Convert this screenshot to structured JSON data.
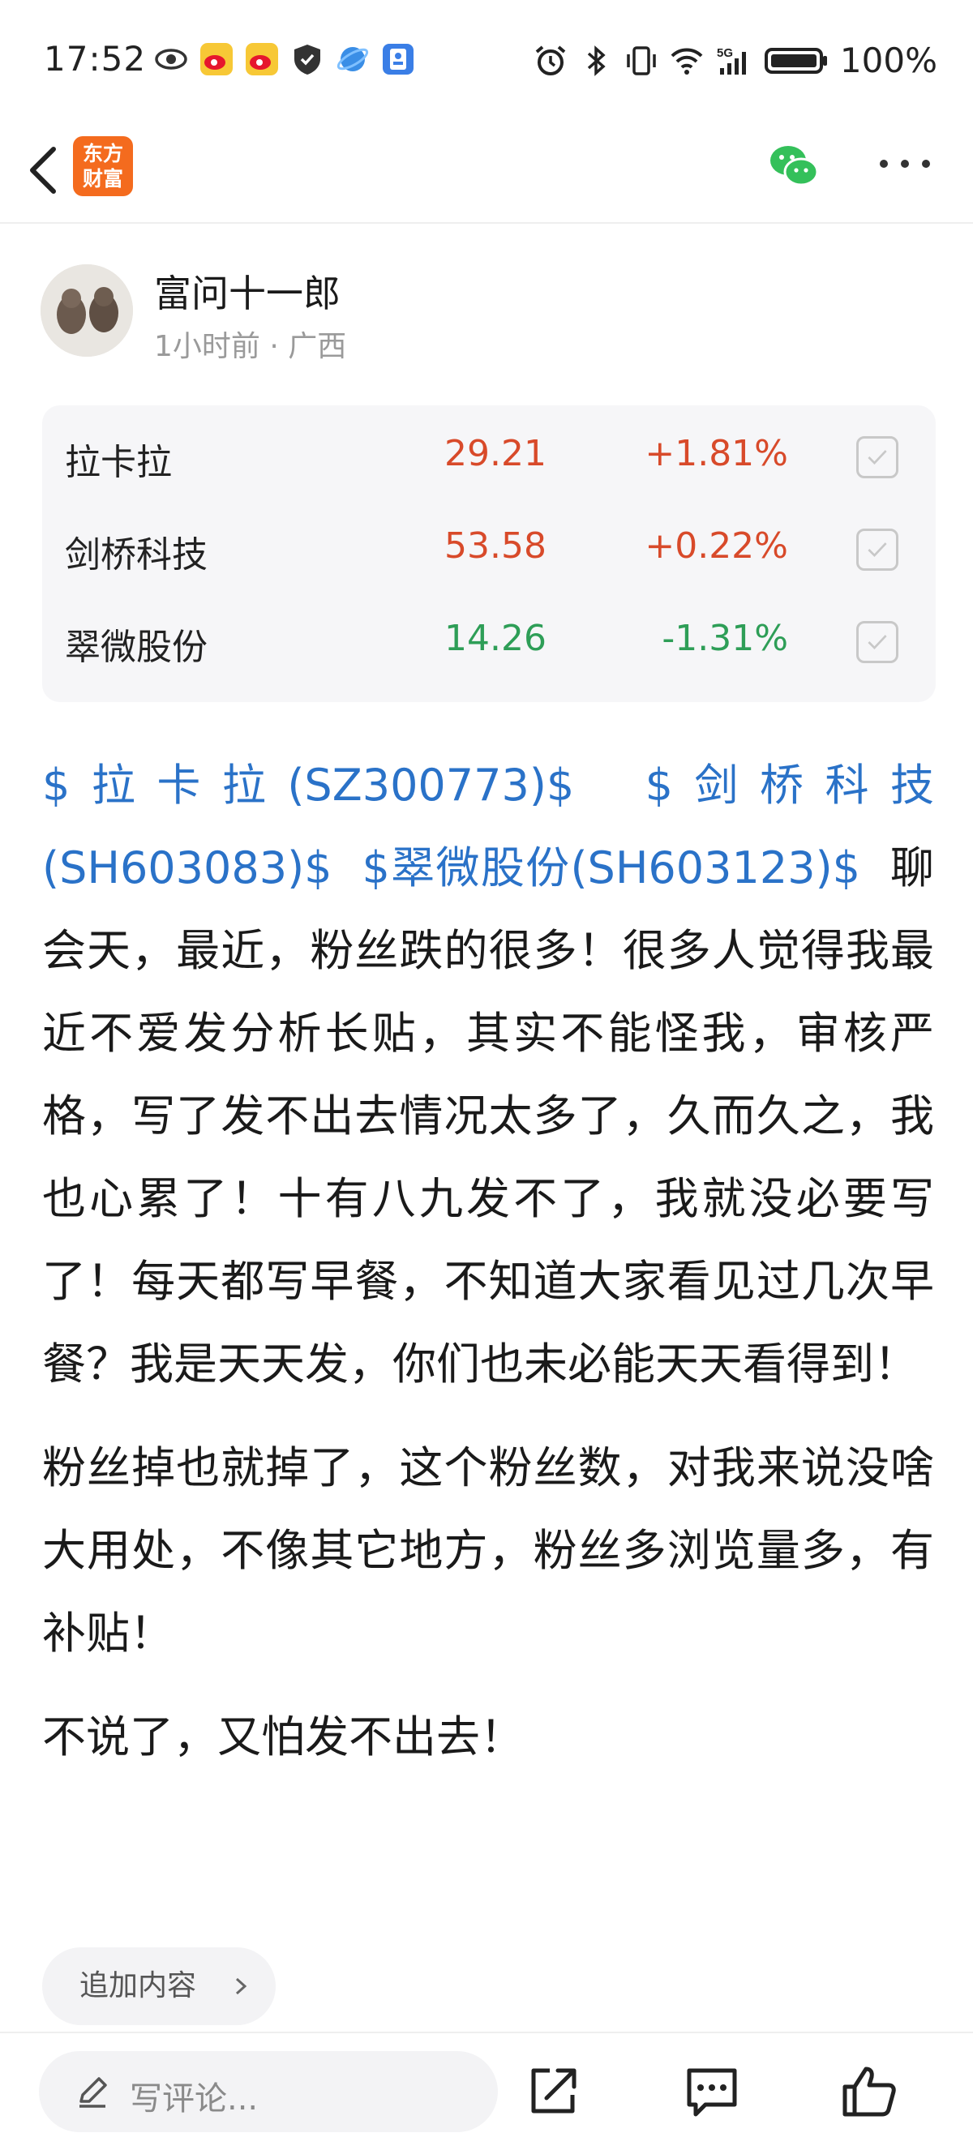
{
  "status_bar": {
    "time": "17:52",
    "battery": "100%",
    "icons_left": [
      "eye-icon",
      "weibo-icon",
      "weibo-icon",
      "shield-icon",
      "browser-icon",
      "id-card-icon"
    ],
    "icons_right": [
      "alarm-icon",
      "bluetooth-icon",
      "vibrate-icon",
      "wifi-icon",
      "signal-5g-icon",
      "battery-icon"
    ]
  },
  "nav": {
    "logo_text_line1": "东方",
    "logo_text_line2": "财富",
    "logo_color": "#f46b1e"
  },
  "author": {
    "name": "富问十一郎",
    "meta": "1小时前 · 广西"
  },
  "stocks": [
    {
      "name": "拉卡拉",
      "price": "29.21",
      "change": "+1.81%",
      "direction": "up"
    },
    {
      "name": "剑桥科技",
      "price": "53.58",
      "change": "+0.22%",
      "direction": "up"
    },
    {
      "name": "翠微股份",
      "price": "14.26",
      "change": "-1.31%",
      "direction": "down"
    }
  ],
  "colors": {
    "up": "#d84a2a",
    "down": "#2e9e57",
    "link": "#2a72c8"
  },
  "post": {
    "link1": "$拉卡拉(SZ300773)$",
    "link2": "$剑桥科技(SH603083)$",
    "link3": "$翠微股份(SH603123)$",
    "paragraph1_rest": "聊会天，最近，粉丝跌的很多！很多人觉得我最近不爱发分析长贴，其实不能怪我，审核严格，写了发不出去情况太多了，久而久之，我也心累了！十有八九发不了，我就没必要写了！每天都写早餐，不知道大家看见过几次早餐？我是天天发，你们也未必能天天看得到！",
    "paragraph2": "粉丝掉也就掉了，这个粉丝数，对我来说没啥大用处，不像其它地方，粉丝多浏览量多，有补贴！",
    "paragraph3": "不说了，又怕发不出去！"
  },
  "add_content_label": "追加内容",
  "bottom_bar": {
    "comment_placeholder": "写评论..."
  }
}
